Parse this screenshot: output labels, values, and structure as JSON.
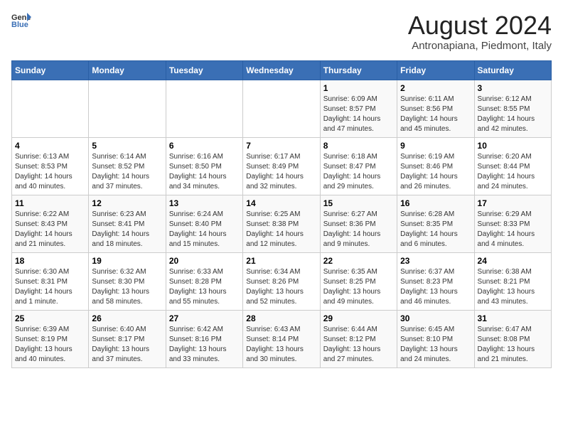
{
  "logo": {
    "text_general": "General",
    "text_blue": "Blue"
  },
  "title": "August 2024",
  "subtitle": "Antronapiana, Piedmont, Italy",
  "days_of_week": [
    "Sunday",
    "Monday",
    "Tuesday",
    "Wednesday",
    "Thursday",
    "Friday",
    "Saturday"
  ],
  "weeks": [
    [
      {
        "num": "",
        "info": ""
      },
      {
        "num": "",
        "info": ""
      },
      {
        "num": "",
        "info": ""
      },
      {
        "num": "",
        "info": ""
      },
      {
        "num": "1",
        "info": "Sunrise: 6:09 AM\nSunset: 8:57 PM\nDaylight: 14 hours\nand 47 minutes."
      },
      {
        "num": "2",
        "info": "Sunrise: 6:11 AM\nSunset: 8:56 PM\nDaylight: 14 hours\nand 45 minutes."
      },
      {
        "num": "3",
        "info": "Sunrise: 6:12 AM\nSunset: 8:55 PM\nDaylight: 14 hours\nand 42 minutes."
      }
    ],
    [
      {
        "num": "4",
        "info": "Sunrise: 6:13 AM\nSunset: 8:53 PM\nDaylight: 14 hours\nand 40 minutes."
      },
      {
        "num": "5",
        "info": "Sunrise: 6:14 AM\nSunset: 8:52 PM\nDaylight: 14 hours\nand 37 minutes."
      },
      {
        "num": "6",
        "info": "Sunrise: 6:16 AM\nSunset: 8:50 PM\nDaylight: 14 hours\nand 34 minutes."
      },
      {
        "num": "7",
        "info": "Sunrise: 6:17 AM\nSunset: 8:49 PM\nDaylight: 14 hours\nand 32 minutes."
      },
      {
        "num": "8",
        "info": "Sunrise: 6:18 AM\nSunset: 8:47 PM\nDaylight: 14 hours\nand 29 minutes."
      },
      {
        "num": "9",
        "info": "Sunrise: 6:19 AM\nSunset: 8:46 PM\nDaylight: 14 hours\nand 26 minutes."
      },
      {
        "num": "10",
        "info": "Sunrise: 6:20 AM\nSunset: 8:44 PM\nDaylight: 14 hours\nand 24 minutes."
      }
    ],
    [
      {
        "num": "11",
        "info": "Sunrise: 6:22 AM\nSunset: 8:43 PM\nDaylight: 14 hours\nand 21 minutes."
      },
      {
        "num": "12",
        "info": "Sunrise: 6:23 AM\nSunset: 8:41 PM\nDaylight: 14 hours\nand 18 minutes."
      },
      {
        "num": "13",
        "info": "Sunrise: 6:24 AM\nSunset: 8:40 PM\nDaylight: 14 hours\nand 15 minutes."
      },
      {
        "num": "14",
        "info": "Sunrise: 6:25 AM\nSunset: 8:38 PM\nDaylight: 14 hours\nand 12 minutes."
      },
      {
        "num": "15",
        "info": "Sunrise: 6:27 AM\nSunset: 8:36 PM\nDaylight: 14 hours\nand 9 minutes."
      },
      {
        "num": "16",
        "info": "Sunrise: 6:28 AM\nSunset: 8:35 PM\nDaylight: 14 hours\nand 6 minutes."
      },
      {
        "num": "17",
        "info": "Sunrise: 6:29 AM\nSunset: 8:33 PM\nDaylight: 14 hours\nand 4 minutes."
      }
    ],
    [
      {
        "num": "18",
        "info": "Sunrise: 6:30 AM\nSunset: 8:31 PM\nDaylight: 14 hours\nand 1 minute."
      },
      {
        "num": "19",
        "info": "Sunrise: 6:32 AM\nSunset: 8:30 PM\nDaylight: 13 hours\nand 58 minutes."
      },
      {
        "num": "20",
        "info": "Sunrise: 6:33 AM\nSunset: 8:28 PM\nDaylight: 13 hours\nand 55 minutes."
      },
      {
        "num": "21",
        "info": "Sunrise: 6:34 AM\nSunset: 8:26 PM\nDaylight: 13 hours\nand 52 minutes."
      },
      {
        "num": "22",
        "info": "Sunrise: 6:35 AM\nSunset: 8:25 PM\nDaylight: 13 hours\nand 49 minutes."
      },
      {
        "num": "23",
        "info": "Sunrise: 6:37 AM\nSunset: 8:23 PM\nDaylight: 13 hours\nand 46 minutes."
      },
      {
        "num": "24",
        "info": "Sunrise: 6:38 AM\nSunset: 8:21 PM\nDaylight: 13 hours\nand 43 minutes."
      }
    ],
    [
      {
        "num": "25",
        "info": "Sunrise: 6:39 AM\nSunset: 8:19 PM\nDaylight: 13 hours\nand 40 minutes."
      },
      {
        "num": "26",
        "info": "Sunrise: 6:40 AM\nSunset: 8:17 PM\nDaylight: 13 hours\nand 37 minutes."
      },
      {
        "num": "27",
        "info": "Sunrise: 6:42 AM\nSunset: 8:16 PM\nDaylight: 13 hours\nand 33 minutes."
      },
      {
        "num": "28",
        "info": "Sunrise: 6:43 AM\nSunset: 8:14 PM\nDaylight: 13 hours\nand 30 minutes."
      },
      {
        "num": "29",
        "info": "Sunrise: 6:44 AM\nSunset: 8:12 PM\nDaylight: 13 hours\nand 27 minutes."
      },
      {
        "num": "30",
        "info": "Sunrise: 6:45 AM\nSunset: 8:10 PM\nDaylight: 13 hours\nand 24 minutes."
      },
      {
        "num": "31",
        "info": "Sunrise: 6:47 AM\nSunset: 8:08 PM\nDaylight: 13 hours\nand 21 minutes."
      }
    ]
  ]
}
